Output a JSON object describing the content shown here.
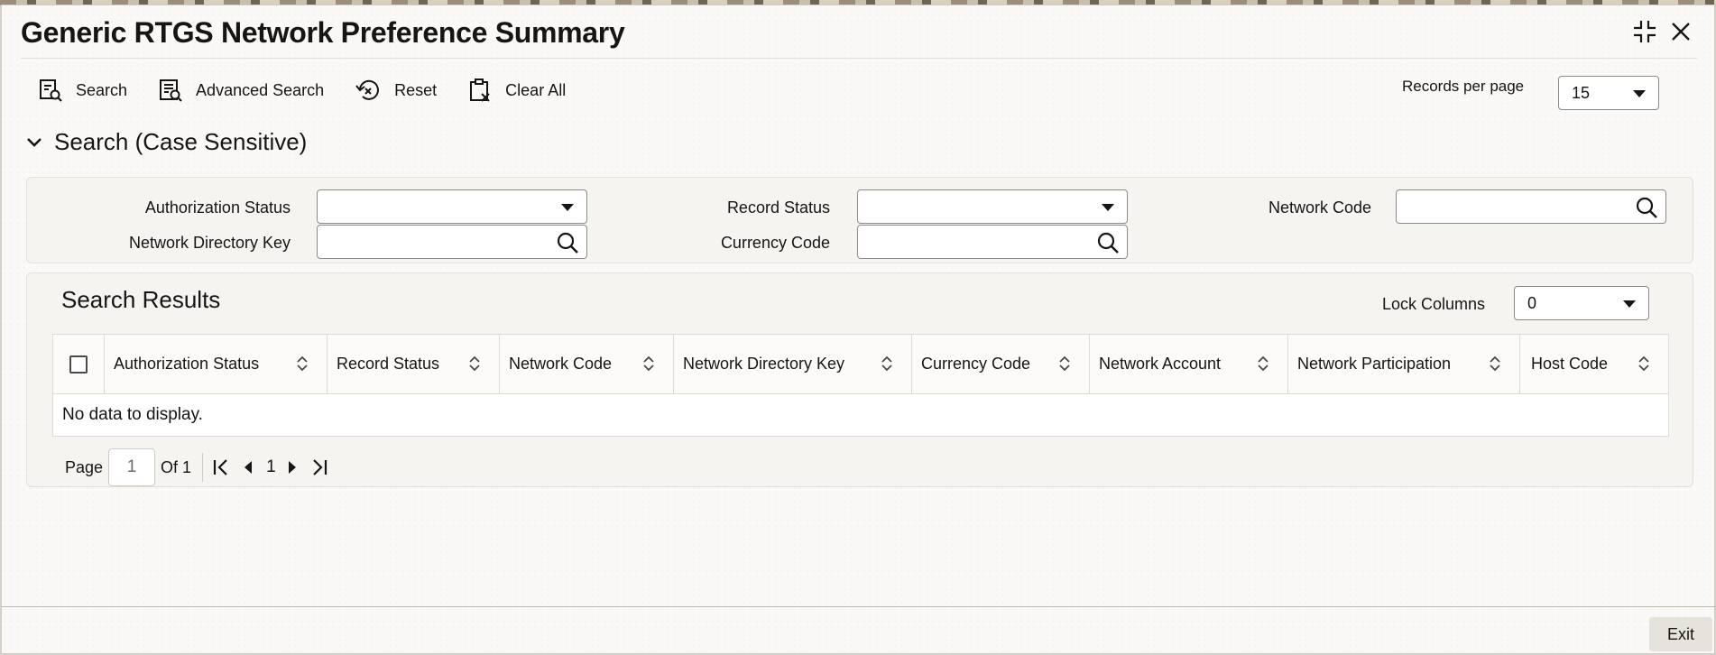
{
  "window": {
    "title": "Generic RTGS Network Preference Summary"
  },
  "toolbar": {
    "search": "Search",
    "advanced_search": "Advanced Search",
    "reset": "Reset",
    "clear_all": "Clear All",
    "records_per_page_label": "Records per page",
    "records_per_page_value": "15"
  },
  "search_section": {
    "title": "Search (Case Sensitive)",
    "fields": {
      "authorization_status": {
        "label": "Authorization Status",
        "value": ""
      },
      "record_status": {
        "label": "Record Status",
        "value": ""
      },
      "network_code": {
        "label": "Network Code",
        "value": ""
      },
      "network_directory_key": {
        "label": "Network Directory Key",
        "value": ""
      },
      "currency_code": {
        "label": "Currency Code",
        "value": ""
      }
    }
  },
  "results": {
    "title": "Search Results",
    "lock_columns_label": "Lock Columns",
    "lock_columns_value": "0",
    "columns": [
      "Authorization Status",
      "Record Status",
      "Network Code",
      "Network Directory Key",
      "Currency Code",
      "Network Account",
      "Network Participation",
      "Host Code"
    ],
    "empty_message": "No data to display."
  },
  "pager": {
    "page_label": "Page",
    "page_value": "1",
    "of_label": "Of 1",
    "current": "1"
  },
  "footer": {
    "exit": "Exit"
  },
  "icons": {
    "search": "search-icon",
    "advanced_search": "advanced-search-icon",
    "reset": "reset-icon",
    "clear_all": "clear-all-icon",
    "collapse": "chevron-down-icon",
    "minimize": "minimize-icon",
    "close": "close-icon",
    "sort": "sort-icon",
    "lookup": "magnifier-icon"
  }
}
